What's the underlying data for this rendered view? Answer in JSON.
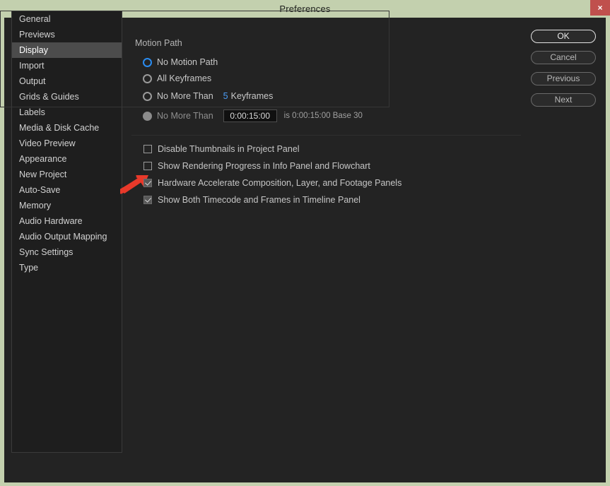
{
  "window": {
    "title": "Preferences",
    "close_label": "×",
    "titlebar_color": "#c3d0ae",
    "close_color": "#c0504d",
    "body_color": "#232323"
  },
  "sidebar": {
    "selected": "Display",
    "items": [
      {
        "label": "General"
      },
      {
        "label": "Previews"
      },
      {
        "label": "Display"
      },
      {
        "label": "Import"
      },
      {
        "label": "Output"
      },
      {
        "label": "Grids & Guides"
      },
      {
        "label": "Labels"
      },
      {
        "label": "Media & Disk Cache"
      },
      {
        "label": "Video Preview"
      },
      {
        "label": "Appearance"
      },
      {
        "label": "New Project"
      },
      {
        "label": "Auto-Save"
      },
      {
        "label": "Memory"
      },
      {
        "label": "Audio Hardware"
      },
      {
        "label": "Audio Output Mapping"
      },
      {
        "label": "Sync Settings"
      },
      {
        "label": "Type"
      }
    ]
  },
  "motion_path": {
    "legend": "Motion Path",
    "accent_color": "#4b9cf5",
    "options": [
      {
        "label": "No Motion Path",
        "selected": true
      },
      {
        "label": "All Keyframes",
        "selected": false
      },
      {
        "label": "No More Than",
        "selected": false,
        "value": "5",
        "suffix": "Keyframes"
      },
      {
        "label": "No More Than",
        "selected": false,
        "disabled": true
      }
    ],
    "timecode": {
      "value": "0:00:15:00",
      "placeholder": "0:00:00:00",
      "suffix": "is 0:00:15:00  Base 30"
    }
  },
  "checkboxes": [
    {
      "label": "Disable Thumbnails in Project Panel",
      "checked": false
    },
    {
      "label": "Show Rendering Progress in Info Panel and Flowchart",
      "checked": false
    },
    {
      "label": "Hardware Accelerate Composition, Layer, and Footage Panels",
      "checked": true
    },
    {
      "label": "Show Both Timecode and Frames in Timeline Panel",
      "checked": true
    }
  ],
  "buttons": [
    {
      "label": "OK",
      "default": true
    },
    {
      "label": "Cancel",
      "default": false
    },
    {
      "label": "Previous",
      "default": false
    },
    {
      "label": "Next",
      "default": false
    }
  ],
  "annotation": {
    "type": "arrow",
    "color": "#e8392a",
    "points_at": "Hardware Accelerate Composition, Layer, and Footage Panels"
  }
}
